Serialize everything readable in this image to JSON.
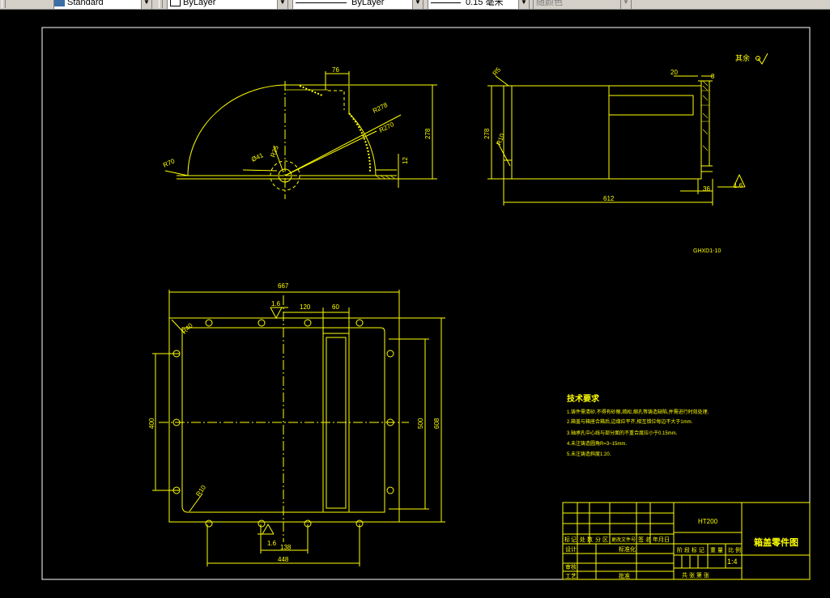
{
  "toolbar": {
    "textstyle": "Standard",
    "layer": "ByLayer",
    "linetype": "ByLayer",
    "lineweight": "0.15 毫米",
    "plotstyle": "随颜色"
  },
  "colors": {
    "line": "#ffff00",
    "frame": "#ffffff",
    "background": "#000000"
  },
  "side_view": {
    "dims": {
      "d76": "76",
      "r278": "R278",
      "r270": "R270",
      "r70": "R70",
      "d41": "Ø41",
      "r25": "R25",
      "d278": "278",
      "d12": "12"
    }
  },
  "right_view": {
    "dims": {
      "r5": "R5",
      "d20": "20",
      "d8": "8",
      "d278": "278",
      "r10": "R10",
      "d612": "612",
      "d36": "36",
      "rough": "1.6"
    },
    "roughness_label": "其余",
    "part_code": "GHXD1-10"
  },
  "plan_view": {
    "dims": {
      "d667": "667",
      "d120": "120",
      "d60": "60",
      "rough_top": "1.6",
      "r40": "R40",
      "d400": "400",
      "d500": "500",
      "d608": "608",
      "r10": "R10",
      "d138": "138",
      "rough_bottom": "1.6",
      "d448": "448"
    }
  },
  "tech": {
    "title": "技术要求",
    "items": [
      "1.铸件需清砂,不得有砂眼,疏松,缩孔等铸造缺陷,并需进行时效处理.",
      "2.箱盖与箱座合箱后,边缘应平齐,相互错位每边不大于1mm.",
      "3.轴承孔中心线与部分面的不重合度应小于0.15mm.",
      "4.未注铸造圆角R=3~15mm.",
      "5.未注铸造斜度1:20."
    ]
  },
  "titleblock": {
    "material": "HT200",
    "name": "箱盖零件图",
    "row_headers": [
      "标",
      "记",
      "处 数",
      "分 区",
      "更改文件号",
      "签 名",
      "年月日"
    ],
    "labels": {
      "design": "设计",
      "standard": "标准化",
      "review": "审核",
      "craft": "工艺",
      "approve": "批准",
      "stage": "阶 段 标 记",
      "weight": "重 量",
      "ratio": "比 例",
      "sheets": "共 张  第 张",
      "scale": "1:4"
    }
  }
}
